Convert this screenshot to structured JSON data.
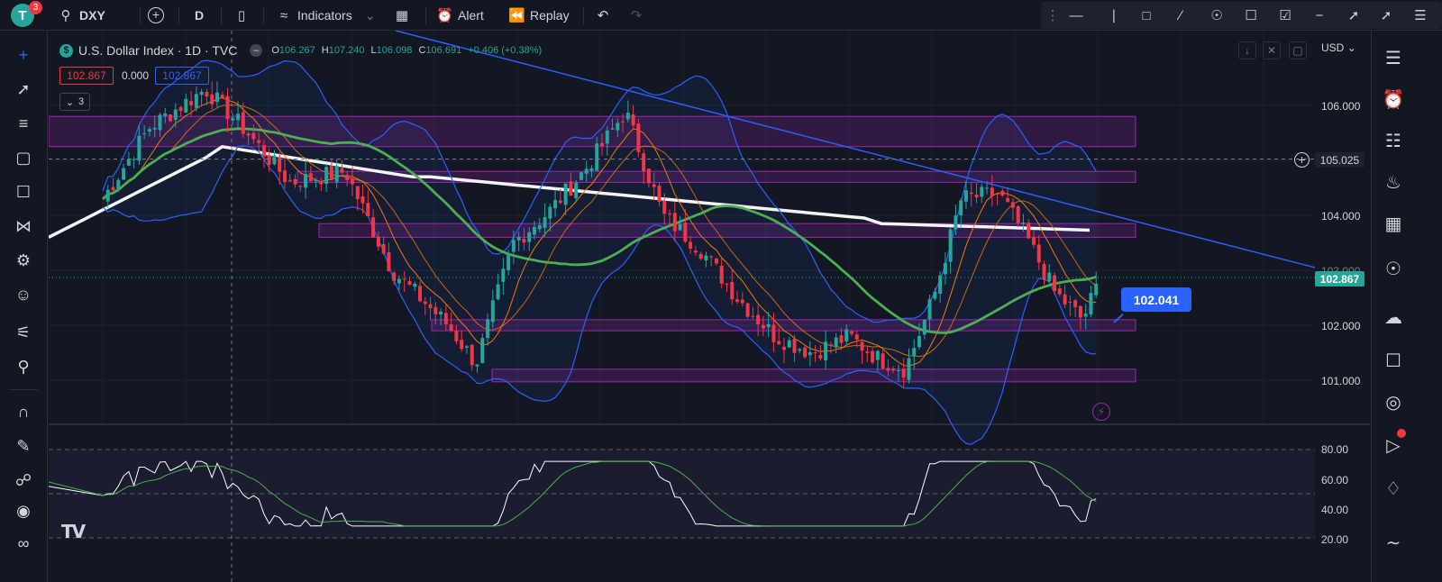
{
  "topbar": {
    "avatar_letter": "T",
    "notification_count": "3",
    "symbol": "DXY",
    "interval": "D",
    "indicators_label": "Indicators",
    "alert_label": "Alert",
    "replay_label": "Replay"
  },
  "legend": {
    "title": "U.S. Dollar Index · 1D · TVC",
    "open_key": "O",
    "open": "106.267",
    "high_key": "H",
    "high": "107.240",
    "low_key": "L",
    "low": "106.098",
    "close_key": "C",
    "close": "106.691",
    "change": "+0.406 (+0.38%)",
    "sell_price": "102.867",
    "spread": "0.000",
    "buy_price": "102.867",
    "indicator_count": "3"
  },
  "price_axis": {
    "currency": "USD",
    "labels": [
      "106.000",
      "105.025",
      "104.000",
      "103.000",
      "102.867",
      "102.000",
      "101.000"
    ],
    "current_price": "102.867",
    "crosshair_price": "105.025"
  },
  "osc_axis": {
    "labels": [
      "80.00",
      "60.00",
      "40.00",
      "20.00"
    ]
  },
  "callout": {
    "text": "102.041"
  },
  "logo_text": "TV",
  "colors": {
    "background": "#131722",
    "up_candle": "#26a69a",
    "down_candle": "#f23645",
    "bollinger": "#2962ff",
    "ma_green": "#4caf50",
    "ma_white": "#ffffff",
    "ema_orange": "#f57c00",
    "zone": "#9c27b0",
    "trendline": "#2962ff"
  },
  "chart_data": {
    "type": "line",
    "price_axis_ticks": [
      101.0,
      102.0,
      103.0,
      104.0,
      106.0
    ],
    "current_price": 102.867,
    "crosshair_price": 105.025,
    "callout_price": 102.041,
    "oscillator_levels": [
      80,
      60,
      40,
      20
    ]
  }
}
